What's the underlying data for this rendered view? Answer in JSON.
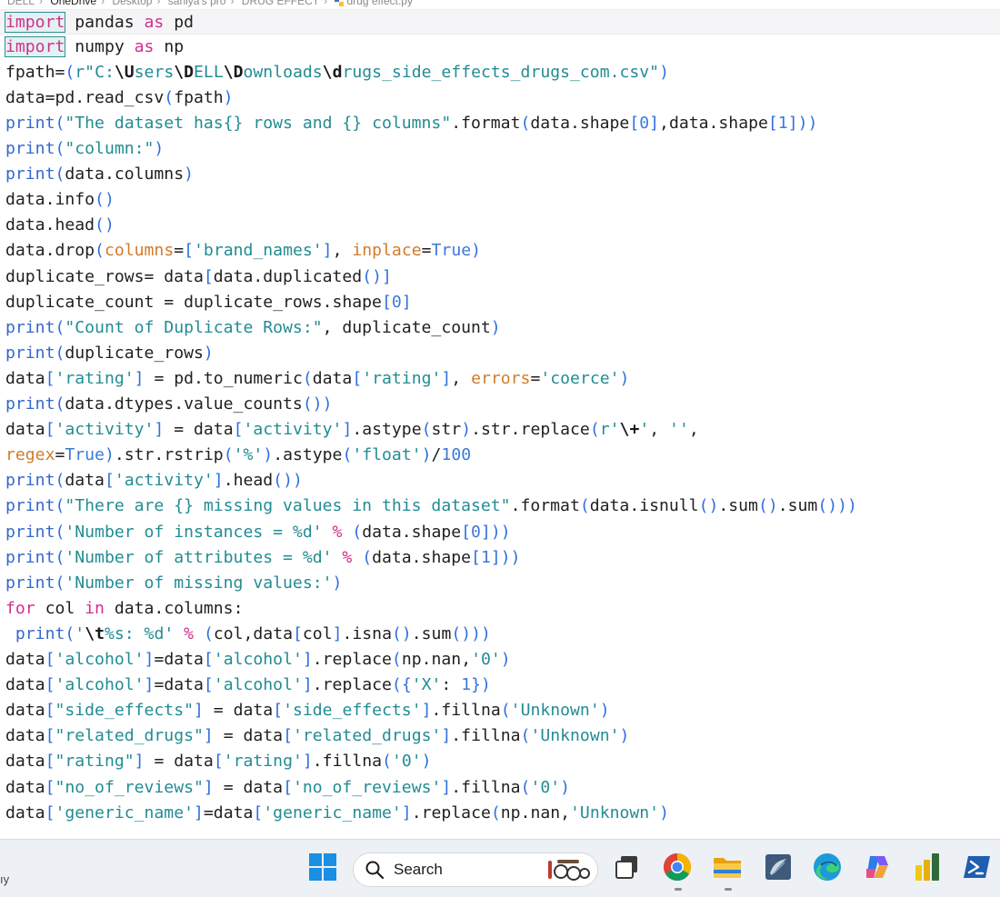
{
  "breadcrumb": {
    "items": [
      "DELL",
      "OneDrive",
      "Desktop",
      "saniya's pro",
      "DRUG EFFECT",
      "drug effect.py"
    ]
  },
  "editor": {
    "lines": [
      [
        {
          "t": "import",
          "c": "kw"
        },
        {
          "t": " pandas ",
          "c": "plain"
        },
        {
          "t": "as",
          "c": "kw"
        },
        {
          "t": " pd",
          "c": "plain"
        }
      ],
      [
        {
          "t": "import",
          "c": "kw"
        },
        {
          "t": " numpy ",
          "c": "plain"
        },
        {
          "t": "as",
          "c": "kw"
        },
        {
          "t": " np",
          "c": "plain"
        }
      ],
      [
        {
          "t": "fpath=",
          "c": "plain"
        },
        {
          "t": "(",
          "c": "br"
        },
        {
          "t": "r\"C:",
          "c": "str"
        },
        {
          "t": "\\U",
          "c": "esc"
        },
        {
          "t": "sers",
          "c": "str"
        },
        {
          "t": "\\D",
          "c": "esc"
        },
        {
          "t": "ELL",
          "c": "str"
        },
        {
          "t": "\\D",
          "c": "esc"
        },
        {
          "t": "ownloads",
          "c": "str"
        },
        {
          "t": "\\d",
          "c": "esc"
        },
        {
          "t": "rugs_side_effects_drugs_com.csv\"",
          "c": "str"
        },
        {
          "t": ")",
          "c": "br"
        }
      ],
      [
        {
          "t": "data=pd.read_csv",
          "c": "plain"
        },
        {
          "t": "(",
          "c": "br"
        },
        {
          "t": "fpath",
          "c": "plain"
        },
        {
          "t": ")",
          "c": "br"
        }
      ],
      [
        {
          "t": "print",
          "c": "fn"
        },
        {
          "t": "(",
          "c": "br"
        },
        {
          "t": "\"The dataset has{} rows and {} columns\"",
          "c": "str"
        },
        {
          "t": ".format",
          "c": "plain"
        },
        {
          "t": "(",
          "c": "br"
        },
        {
          "t": "data.shape",
          "c": "plain"
        },
        {
          "t": "[",
          "c": "br"
        },
        {
          "t": "0",
          "c": "num"
        },
        {
          "t": "]",
          "c": "br"
        },
        {
          "t": ",data.shape",
          "c": "plain"
        },
        {
          "t": "[",
          "c": "br"
        },
        {
          "t": "1",
          "c": "num"
        },
        {
          "t": "]",
          "c": "br"
        },
        {
          "t": "))",
          "c": "br"
        }
      ],
      [
        {
          "t": "print",
          "c": "fn"
        },
        {
          "t": "(",
          "c": "br"
        },
        {
          "t": "\"column:\"",
          "c": "str"
        },
        {
          "t": ")",
          "c": "br"
        }
      ],
      [
        {
          "t": "print",
          "c": "fn"
        },
        {
          "t": "(",
          "c": "br"
        },
        {
          "t": "data.columns",
          "c": "plain"
        },
        {
          "t": ")",
          "c": "br"
        }
      ],
      [
        {
          "t": "data.info",
          "c": "plain"
        },
        {
          "t": "()",
          "c": "br"
        }
      ],
      [
        {
          "t": "data.head",
          "c": "plain"
        },
        {
          "t": "()",
          "c": "br"
        }
      ],
      [
        {
          "t": "data.drop",
          "c": "plain"
        },
        {
          "t": "(",
          "c": "br"
        },
        {
          "t": "columns",
          "c": "par"
        },
        {
          "t": "=",
          "c": "plain"
        },
        {
          "t": "[",
          "c": "br"
        },
        {
          "t": "'brand_names'",
          "c": "str"
        },
        {
          "t": "]",
          "c": "br"
        },
        {
          "t": ", ",
          "c": "plain"
        },
        {
          "t": "inplace",
          "c": "par"
        },
        {
          "t": "=",
          "c": "plain"
        },
        {
          "t": "True",
          "c": "num"
        },
        {
          "t": ")",
          "c": "br"
        }
      ],
      [
        {
          "t": "duplicate_rows= data",
          "c": "plain"
        },
        {
          "t": "[",
          "c": "br"
        },
        {
          "t": "data.duplicated",
          "c": "plain"
        },
        {
          "t": "()",
          "c": "br"
        },
        {
          "t": "]",
          "c": "br"
        }
      ],
      [
        {
          "t": "duplicate_count = duplicate_rows.shape",
          "c": "plain"
        },
        {
          "t": "[",
          "c": "br"
        },
        {
          "t": "0",
          "c": "num"
        },
        {
          "t": "]",
          "c": "br"
        }
      ],
      [
        {
          "t": "print",
          "c": "fn"
        },
        {
          "t": "(",
          "c": "br"
        },
        {
          "t": "\"Count of Duplicate Rows:\"",
          "c": "str"
        },
        {
          "t": ", duplicate_count",
          "c": "plain"
        },
        {
          "t": ")",
          "c": "br"
        }
      ],
      [
        {
          "t": "print",
          "c": "fn"
        },
        {
          "t": "(",
          "c": "br"
        },
        {
          "t": "duplicate_rows",
          "c": "plain"
        },
        {
          "t": ")",
          "c": "br"
        }
      ],
      [
        {
          "t": "data",
          "c": "plain"
        },
        {
          "t": "[",
          "c": "br"
        },
        {
          "t": "'rating'",
          "c": "str"
        },
        {
          "t": "]",
          "c": "br"
        },
        {
          "t": " = pd.to_numeric",
          "c": "plain"
        },
        {
          "t": "(",
          "c": "br"
        },
        {
          "t": "data",
          "c": "plain"
        },
        {
          "t": "[",
          "c": "br"
        },
        {
          "t": "'rating'",
          "c": "str"
        },
        {
          "t": "]",
          "c": "br"
        },
        {
          "t": ", ",
          "c": "plain"
        },
        {
          "t": "errors",
          "c": "par"
        },
        {
          "t": "=",
          "c": "plain"
        },
        {
          "t": "'coerce'",
          "c": "str"
        },
        {
          "t": ")",
          "c": "br"
        }
      ],
      [
        {
          "t": "print",
          "c": "fn"
        },
        {
          "t": "(",
          "c": "br"
        },
        {
          "t": "data.dtypes.value_counts",
          "c": "plain"
        },
        {
          "t": "())",
          "c": "br"
        }
      ],
      [
        {
          "t": "data",
          "c": "plain"
        },
        {
          "t": "[",
          "c": "br"
        },
        {
          "t": "'activity'",
          "c": "str"
        },
        {
          "t": "]",
          "c": "br"
        },
        {
          "t": " = data",
          "c": "plain"
        },
        {
          "t": "[",
          "c": "br"
        },
        {
          "t": "'activity'",
          "c": "str"
        },
        {
          "t": "]",
          "c": "br"
        },
        {
          "t": ".astype",
          "c": "plain"
        },
        {
          "t": "(",
          "c": "br"
        },
        {
          "t": "str",
          "c": "plain"
        },
        {
          "t": ")",
          "c": "br"
        },
        {
          "t": ".str.replace",
          "c": "plain"
        },
        {
          "t": "(",
          "c": "br"
        },
        {
          "t": "r'",
          "c": "str"
        },
        {
          "t": "\\+",
          "c": "esc"
        },
        {
          "t": "'",
          "c": "str"
        },
        {
          "t": ", ",
          "c": "plain"
        },
        {
          "t": "''",
          "c": "str"
        },
        {
          "t": ",",
          "c": "plain"
        }
      ],
      [
        {
          "t": "regex",
          "c": "par"
        },
        {
          "t": "=",
          "c": "plain"
        },
        {
          "t": "True",
          "c": "num"
        },
        {
          "t": ")",
          "c": "br"
        },
        {
          "t": ".str.rstrip",
          "c": "plain"
        },
        {
          "t": "(",
          "c": "br"
        },
        {
          "t": "'%'",
          "c": "str"
        },
        {
          "t": ")",
          "c": "br"
        },
        {
          "t": ".astype",
          "c": "plain"
        },
        {
          "t": "(",
          "c": "br"
        },
        {
          "t": "'float'",
          "c": "str"
        },
        {
          "t": ")",
          "c": "br"
        },
        {
          "t": "/",
          "c": "plain"
        },
        {
          "t": "100",
          "c": "num"
        }
      ],
      [
        {
          "t": "print",
          "c": "fn"
        },
        {
          "t": "(",
          "c": "br"
        },
        {
          "t": "data",
          "c": "plain"
        },
        {
          "t": "[",
          "c": "br"
        },
        {
          "t": "'activity'",
          "c": "str"
        },
        {
          "t": "]",
          "c": "br"
        },
        {
          "t": ".head",
          "c": "plain"
        },
        {
          "t": "())",
          "c": "br"
        }
      ],
      [
        {
          "t": "print",
          "c": "fn"
        },
        {
          "t": "(",
          "c": "br"
        },
        {
          "t": "\"There are {} missing values in this dataset\"",
          "c": "str"
        },
        {
          "t": ".format",
          "c": "plain"
        },
        {
          "t": "(",
          "c": "br"
        },
        {
          "t": "data.isnull",
          "c": "plain"
        },
        {
          "t": "()",
          "c": "br"
        },
        {
          "t": ".sum",
          "c": "plain"
        },
        {
          "t": "()",
          "c": "br"
        },
        {
          "t": ".sum",
          "c": "plain"
        },
        {
          "t": "()))",
          "c": "br"
        }
      ],
      [
        {
          "t": "print",
          "c": "fn"
        },
        {
          "t": "(",
          "c": "br"
        },
        {
          "t": "'Number of instances = %d'",
          "c": "str"
        },
        {
          "t": " % ",
          "c": "kw"
        },
        {
          "t": "(",
          "c": "br"
        },
        {
          "t": "data.shape",
          "c": "plain"
        },
        {
          "t": "[",
          "c": "br"
        },
        {
          "t": "0",
          "c": "num"
        },
        {
          "t": "]",
          "c": "br"
        },
        {
          "t": "))",
          "c": "br"
        }
      ],
      [
        {
          "t": "print",
          "c": "fn"
        },
        {
          "t": "(",
          "c": "br"
        },
        {
          "t": "'Number of attributes = %d'",
          "c": "str"
        },
        {
          "t": " % ",
          "c": "kw"
        },
        {
          "t": "(",
          "c": "br"
        },
        {
          "t": "data.shape",
          "c": "plain"
        },
        {
          "t": "[",
          "c": "br"
        },
        {
          "t": "1",
          "c": "num"
        },
        {
          "t": "]",
          "c": "br"
        },
        {
          "t": "))",
          "c": "br"
        }
      ],
      [
        {
          "t": "print",
          "c": "fn"
        },
        {
          "t": "(",
          "c": "br"
        },
        {
          "t": "'Number of missing values:'",
          "c": "str"
        },
        {
          "t": ")",
          "c": "br"
        }
      ],
      [
        {
          "t": "for",
          "c": "kw"
        },
        {
          "t": " col ",
          "c": "plain"
        },
        {
          "t": "in",
          "c": "kw"
        },
        {
          "t": " data.columns:",
          "c": "plain"
        }
      ],
      [
        {
          "t": " print",
          "c": "fn"
        },
        {
          "t": "(",
          "c": "br"
        },
        {
          "t": "'",
          "c": "str"
        },
        {
          "t": "\\t",
          "c": "esc"
        },
        {
          "t": "%s: %d'",
          "c": "str"
        },
        {
          "t": " % ",
          "c": "kw"
        },
        {
          "t": "(",
          "c": "br"
        },
        {
          "t": "col,data",
          "c": "plain"
        },
        {
          "t": "[",
          "c": "br"
        },
        {
          "t": "col",
          "c": "plain"
        },
        {
          "t": "]",
          "c": "br"
        },
        {
          "t": ".isna",
          "c": "plain"
        },
        {
          "t": "()",
          "c": "br"
        },
        {
          "t": ".sum",
          "c": "plain"
        },
        {
          "t": "()))",
          "c": "br"
        }
      ],
      [
        {
          "t": "data",
          "c": "plain"
        },
        {
          "t": "[",
          "c": "br"
        },
        {
          "t": "'alcohol'",
          "c": "str"
        },
        {
          "t": "]",
          "c": "br"
        },
        {
          "t": "=data",
          "c": "plain"
        },
        {
          "t": "[",
          "c": "br"
        },
        {
          "t": "'alcohol'",
          "c": "str"
        },
        {
          "t": "]",
          "c": "br"
        },
        {
          "t": ".replace",
          "c": "plain"
        },
        {
          "t": "(",
          "c": "br"
        },
        {
          "t": "np.nan,",
          "c": "plain"
        },
        {
          "t": "'0'",
          "c": "str"
        },
        {
          "t": ")",
          "c": "br"
        }
      ],
      [
        {
          "t": "data",
          "c": "plain"
        },
        {
          "t": "[",
          "c": "br"
        },
        {
          "t": "'alcohol'",
          "c": "str"
        },
        {
          "t": "]",
          "c": "br"
        },
        {
          "t": "=data",
          "c": "plain"
        },
        {
          "t": "[",
          "c": "br"
        },
        {
          "t": "'alcohol'",
          "c": "str"
        },
        {
          "t": "]",
          "c": "br"
        },
        {
          "t": ".replace",
          "c": "plain"
        },
        {
          "t": "({",
          "c": "br"
        },
        {
          "t": "'X'",
          "c": "str"
        },
        {
          "t": ": ",
          "c": "plain"
        },
        {
          "t": "1",
          "c": "num"
        },
        {
          "t": "})",
          "c": "br"
        }
      ],
      [
        {
          "t": "data",
          "c": "plain"
        },
        {
          "t": "[",
          "c": "br"
        },
        {
          "t": "\"side_effects\"",
          "c": "str"
        },
        {
          "t": "]",
          "c": "br"
        },
        {
          "t": " = data",
          "c": "plain"
        },
        {
          "t": "[",
          "c": "br"
        },
        {
          "t": "'side_effects'",
          "c": "str"
        },
        {
          "t": "]",
          "c": "br"
        },
        {
          "t": ".fillna",
          "c": "plain"
        },
        {
          "t": "(",
          "c": "br"
        },
        {
          "t": "'Unknown'",
          "c": "str"
        },
        {
          "t": ")",
          "c": "br"
        }
      ],
      [
        {
          "t": "data",
          "c": "plain"
        },
        {
          "t": "[",
          "c": "br"
        },
        {
          "t": "\"related_drugs\"",
          "c": "str"
        },
        {
          "t": "]",
          "c": "br"
        },
        {
          "t": " = data",
          "c": "plain"
        },
        {
          "t": "[",
          "c": "br"
        },
        {
          "t": "'related_drugs'",
          "c": "str"
        },
        {
          "t": "]",
          "c": "br"
        },
        {
          "t": ".fillna",
          "c": "plain"
        },
        {
          "t": "(",
          "c": "br"
        },
        {
          "t": "'Unknown'",
          "c": "str"
        },
        {
          "t": ")",
          "c": "br"
        }
      ],
      [
        {
          "t": "data",
          "c": "plain"
        },
        {
          "t": "[",
          "c": "br"
        },
        {
          "t": "\"rating\"",
          "c": "str"
        },
        {
          "t": "]",
          "c": "br"
        },
        {
          "t": " = data",
          "c": "plain"
        },
        {
          "t": "[",
          "c": "br"
        },
        {
          "t": "'rating'",
          "c": "str"
        },
        {
          "t": "]",
          "c": "br"
        },
        {
          "t": ".fillna",
          "c": "plain"
        },
        {
          "t": "(",
          "c": "br"
        },
        {
          "t": "'0'",
          "c": "str"
        },
        {
          "t": ")",
          "c": "br"
        }
      ],
      [
        {
          "t": "data",
          "c": "plain"
        },
        {
          "t": "[",
          "c": "br"
        },
        {
          "t": "\"no_of_reviews\"",
          "c": "str"
        },
        {
          "t": "]",
          "c": "br"
        },
        {
          "t": " = data",
          "c": "plain"
        },
        {
          "t": "[",
          "c": "br"
        },
        {
          "t": "'no_of_reviews'",
          "c": "str"
        },
        {
          "t": "]",
          "c": "br"
        },
        {
          "t": ".fillna",
          "c": "plain"
        },
        {
          "t": "(",
          "c": "br"
        },
        {
          "t": "'0'",
          "c": "str"
        },
        {
          "t": ")",
          "c": "br"
        }
      ],
      [
        {
          "t": "data",
          "c": "plain"
        },
        {
          "t": "[",
          "c": "br"
        },
        {
          "t": "'generic_name'",
          "c": "str"
        },
        {
          "t": "]",
          "c": "br"
        },
        {
          "t": "=data",
          "c": "plain"
        },
        {
          "t": "[",
          "c": "br"
        },
        {
          "t": "'generic_name'",
          "c": "str"
        },
        {
          "t": "]",
          "c": "br"
        },
        {
          "t": ".replace",
          "c": "plain"
        },
        {
          "t": "(",
          "c": "br"
        },
        {
          "t": "np.nan,",
          "c": "plain"
        },
        {
          "t": "'Unknown'",
          "c": "str"
        },
        {
          "t": ")",
          "c": "br"
        }
      ]
    ]
  },
  "taskbar": {
    "left_text": "ıy",
    "search_label": "Search",
    "apps": [
      "windows-start-icon",
      "task-view-icon",
      "chrome-icon",
      "file-explorer-icon",
      "sql-server-icon",
      "edge-icon",
      "copilot-icon",
      "power-bi-icon",
      "powershell-icon"
    ]
  },
  "colors": {
    "keyword": "#d22f8e",
    "function": "#3568cf",
    "string": "#228c93",
    "number": "#3c7ad6",
    "parameter": "#d27c2a",
    "bracket": "#2f6fe0",
    "taskbar_bg": "#edf0f5"
  }
}
